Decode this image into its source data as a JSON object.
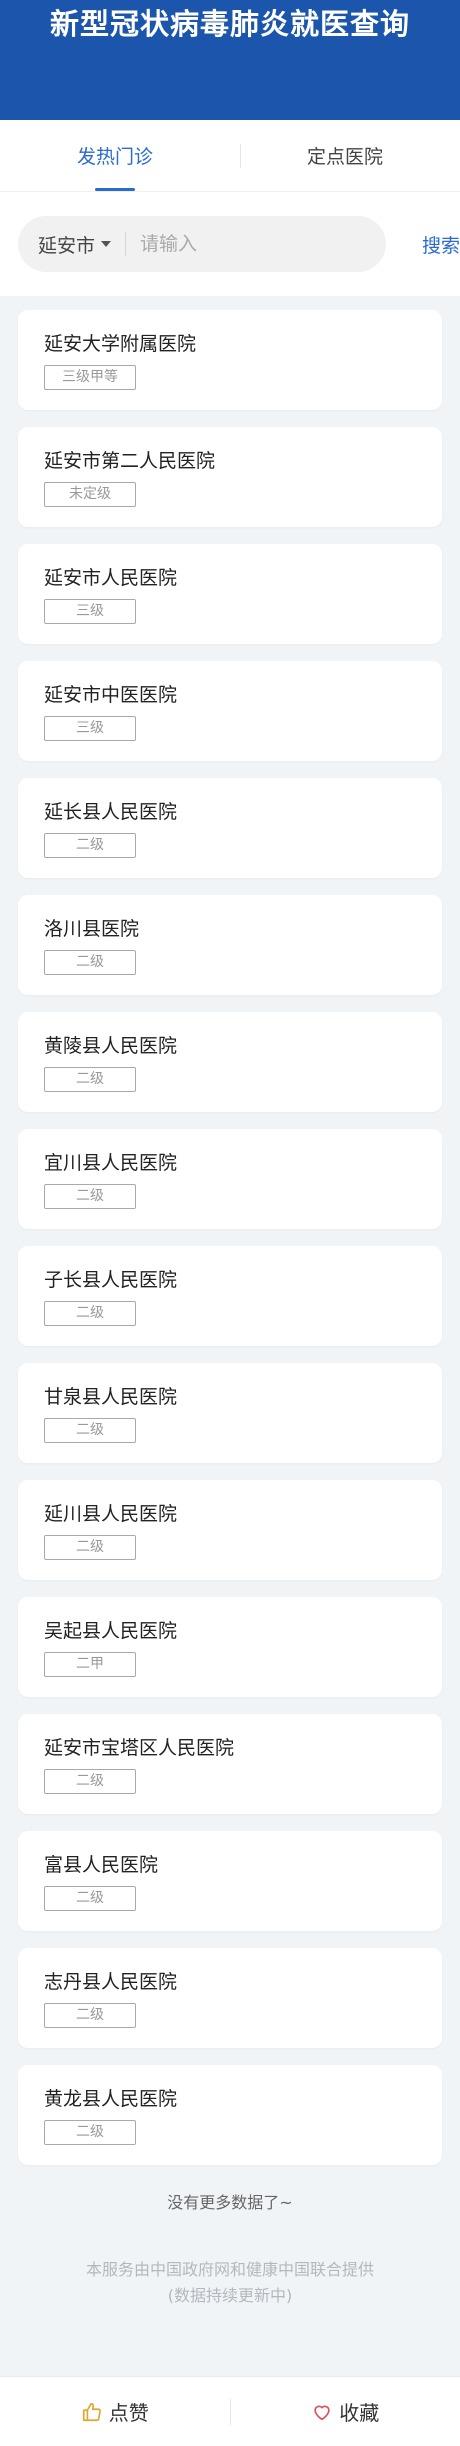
{
  "header": {
    "title": "新型冠状病毒肺炎就医查询"
  },
  "tabs": [
    {
      "label": "发热门诊",
      "active": true
    },
    {
      "label": "定点医院",
      "active": false
    }
  ],
  "search": {
    "city": "延安市",
    "placeholder": "请输入",
    "value": "",
    "button_label": "搜索"
  },
  "hospitals": [
    {
      "name": "延安大学附属医院",
      "level": "三级甲等"
    },
    {
      "name": "延安市第二人民医院",
      "level": "未定级"
    },
    {
      "name": "延安市人民医院",
      "level": "三级"
    },
    {
      "name": "延安市中医医院",
      "level": "三级"
    },
    {
      "name": "延长县人民医院",
      "level": "二级"
    },
    {
      "name": "洛川县医院",
      "level": "二级"
    },
    {
      "name": "黄陵县人民医院",
      "level": "二级"
    },
    {
      "name": "宜川县人民医院",
      "level": "二级"
    },
    {
      "name": "子长县人民医院",
      "level": "二级"
    },
    {
      "name": "甘泉县人民医院",
      "level": "二级"
    },
    {
      "name": "延川县人民医院",
      "level": "二级"
    },
    {
      "name": "吴起县人民医院",
      "level": "二甲"
    },
    {
      "name": "延安市宝塔区人民医院",
      "level": "二级"
    },
    {
      "name": "富县人民医院",
      "level": "二级"
    },
    {
      "name": "志丹县人民医院",
      "level": "二级"
    },
    {
      "name": "黄龙县人民医院",
      "level": "二级"
    }
  ],
  "no_more": "没有更多数据了~",
  "footnote": {
    "line1": "本服务由中国政府网和健康中国联合提供",
    "line2": "(数据持续更新中)"
  },
  "bottom_bar": {
    "like_label": "点赞",
    "favorite_label": "收藏"
  },
  "colors": {
    "header_bg": "#1b56ac",
    "accent": "#2a6bd0",
    "like_icon": "#e2a52d",
    "favorite_icon": "#e0505a"
  },
  "icons": {
    "city_dropdown": "caret-down-icon",
    "like": "thumbs-up-icon",
    "favorite": "heart-icon"
  }
}
